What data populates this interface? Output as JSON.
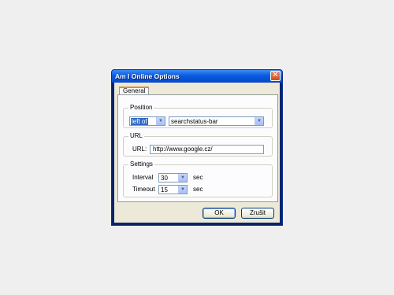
{
  "window": {
    "title": "Am I Online Options",
    "close_icon": "close-icon"
  },
  "tabs": [
    {
      "label": "General",
      "selected": true
    }
  ],
  "position_group": {
    "title": "Position",
    "relation_value": "left of",
    "target_value": "searchstatus-bar"
  },
  "url_group": {
    "title": "URL",
    "label": "URL:",
    "value": "http://www.google.cz/"
  },
  "settings_group": {
    "title": "Settings",
    "interval_label": "Interval",
    "interval_value": "30",
    "interval_unit": "sec",
    "timeout_label": "Timeout",
    "timeout_value": "15",
    "timeout_unit": "sec"
  },
  "buttons": {
    "ok": "OK",
    "cancel": "Zrušit"
  }
}
